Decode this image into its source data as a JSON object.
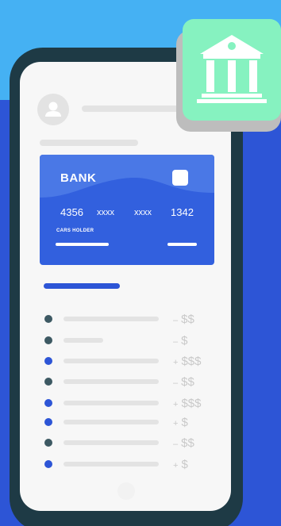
{
  "card": {
    "title": "BANK",
    "number_groups": [
      "4356",
      "xxxx",
      "xxxx",
      "1342"
    ],
    "holder_label": "CARS HOLDER"
  },
  "transactions": [
    {
      "type": "debit",
      "sign": "–",
      "amount": "$$"
    },
    {
      "type": "debit",
      "sign": "–",
      "amount": "$"
    },
    {
      "type": "credit",
      "sign": "+",
      "amount": "$$$"
    },
    {
      "type": "debit",
      "sign": "–",
      "amount": "$$"
    },
    {
      "type": "credit",
      "sign": "+",
      "amount": "$$$"
    },
    {
      "type": "credit",
      "sign": "+",
      "amount": "$"
    },
    {
      "type": "debit",
      "sign": "–",
      "amount": "$$"
    },
    {
      "type": "credit",
      "sign": "+",
      "amount": "$"
    }
  ],
  "colors": {
    "sky": "#45b1f3",
    "background": "#2d55d6",
    "card": "#3260de",
    "bank_tile": "#86f2c0",
    "credit_dot": "#2d55d6",
    "debit_dot": "#3d5963"
  },
  "icons": {
    "bank": "bank-building-icon",
    "avatar": "user-avatar-icon"
  }
}
